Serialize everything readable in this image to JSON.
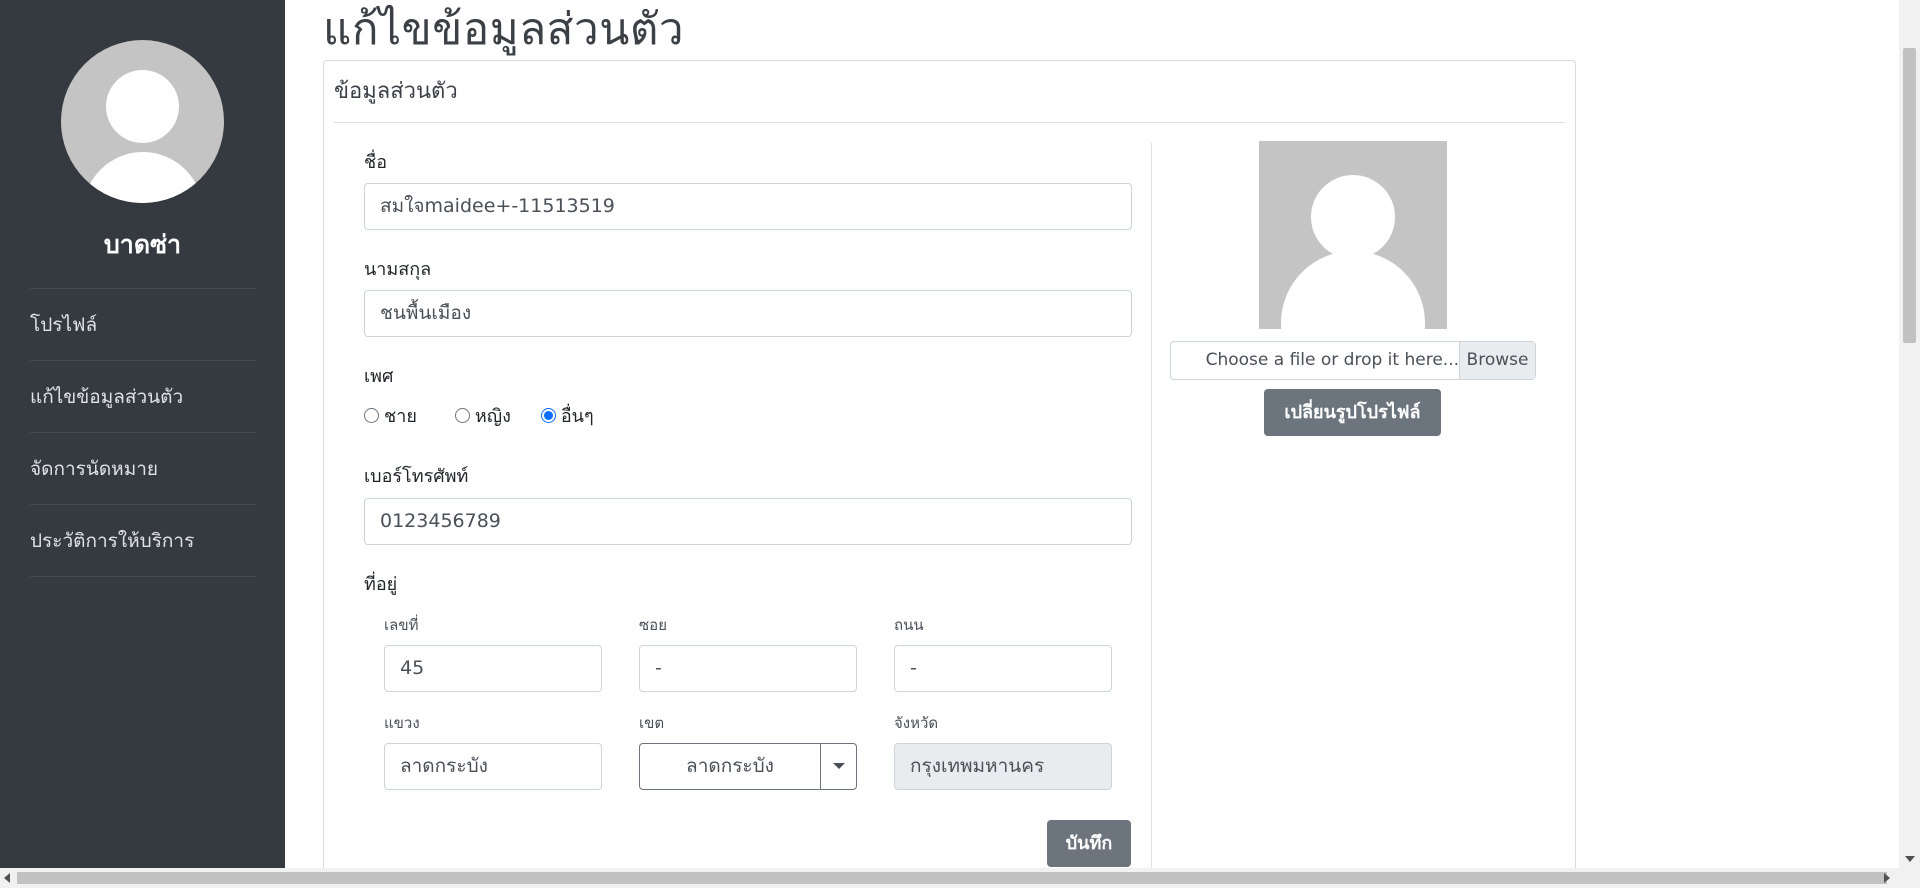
{
  "sidebar": {
    "user_name": "บาดซ่า",
    "items": [
      {
        "label": "โปรไฟล์"
      },
      {
        "label": "แก้ไขข้อมูลส่วนตัว"
      },
      {
        "label": "จัดการนัดหมาย"
      },
      {
        "label": "ประวัติการให้บริการ"
      }
    ]
  },
  "page": {
    "title": "แก้ไขข้อมูลส่วนตัว",
    "card_header": "ข้อมูลส่วนตัว"
  },
  "form": {
    "first_name_label": "ชื่อ",
    "first_name_value": "สมใจmaidee+-11513519",
    "last_name_label": "นามสกุล",
    "last_name_value": "ชนพื้นเมือง",
    "gender_label": "เพศ",
    "gender_options": [
      {
        "label": "ชาย",
        "selected": false
      },
      {
        "label": "หญิง",
        "selected": false
      },
      {
        "label": "อื่นๆ",
        "selected": true
      }
    ],
    "phone_label": "เบอร์โทรศัพท์",
    "phone_value": "0123456789",
    "address_label": "ที่อยู่",
    "house_no_label": "เลขที่",
    "house_no_value": "45",
    "soi_label": "ซอย",
    "soi_value": "-",
    "road_label": "ถนน",
    "road_value": "-",
    "subdistrict_label": "แขวง",
    "subdistrict_value": "ลาดกระบัง",
    "district_label": "เขต",
    "district_value": "ลาดกระบัง",
    "province_label": "จังหวัด",
    "province_value": "กรุงเทพมหานคร",
    "save_label": "บันทึก"
  },
  "profile_picture": {
    "file_placeholder": "Choose a file or drop it here...",
    "browse_label": "Browse",
    "change_label": "เปลี่ยนรูปโปรไฟล์"
  },
  "colors": {
    "sidebar_bg": "#343a40",
    "button_bg": "#6c757d",
    "radio_accent": "#0d6efd"
  }
}
